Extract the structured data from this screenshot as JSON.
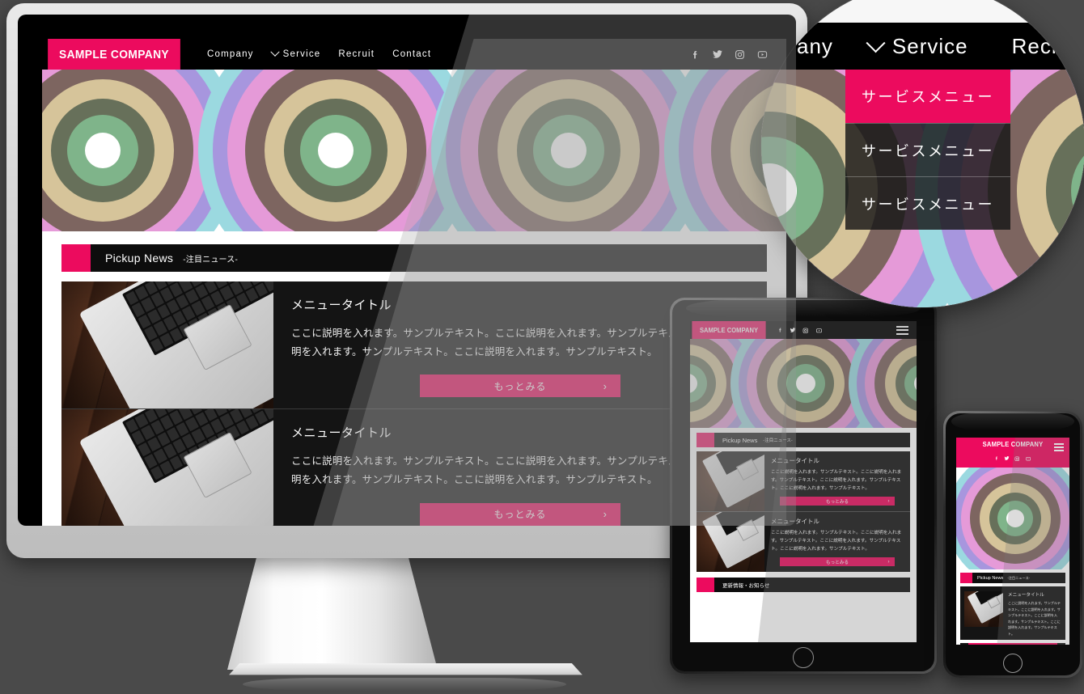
{
  "brand": {
    "name": "SAMPLE COMPANY",
    "accent": "#ec0b5e",
    "dark": "#000000"
  },
  "nav": {
    "items": [
      {
        "label": "Company",
        "has_dropdown": false
      },
      {
        "label": "Service",
        "has_dropdown": true
      },
      {
        "label": "Recruit",
        "has_dropdown": false
      },
      {
        "label": "Contact",
        "has_dropdown": false
      }
    ]
  },
  "social": [
    {
      "name": "facebook-icon",
      "glyph": "f"
    },
    {
      "name": "twitter-icon",
      "glyph": "t"
    },
    {
      "name": "instagram-icon",
      "glyph": "ig"
    },
    {
      "name": "youtube-icon",
      "glyph": "yt"
    }
  ],
  "pickup_news": {
    "en": "Pickup News",
    "ja": "-注目ニュース-"
  },
  "updates_section": {
    "ja": "更新情報・お知らせ"
  },
  "cards": [
    {
      "title": "メニュータイトル",
      "text": "ここに説明を入れます。サンプルテキスト。ここに説明を入れます。サンプルテキスト。ここに説明を入れます。サンプルテキスト。ここに説明を入れます。サンプルテキスト。",
      "button": "もっとみる",
      "button_arrow": "›"
    },
    {
      "title": "メニュータイトル",
      "text": "ここに説明を入れます。サンプルテキスト。ここに説明を入れます。サンプルテキスト。ここに説明を入れます。サンプルテキスト。ここに説明を入れます。サンプルテキスト。",
      "button": "もっとみる",
      "button_arrow": "›"
    }
  ],
  "magnifier": {
    "nav_left": "any",
    "nav_service": "Service",
    "nav_right": "Recruit",
    "dropdown": [
      {
        "label": "サービスメニュー",
        "state": "active"
      },
      {
        "label": "サービスメニュー",
        "state": "normal"
      },
      {
        "label": "サービスメニュー",
        "state": "normal"
      }
    ]
  },
  "hero_rings": {
    "colors": [
      "#ffffff",
      "#7fb48a",
      "#67705a",
      "#d6c49a",
      "#7d6560",
      "#e59ad8",
      "#a796de",
      "#9bd9e0"
    ],
    "description": "concentric-rings-pattern"
  },
  "devices": [
    {
      "name": "desktop-monitor",
      "type": "imac"
    },
    {
      "name": "tablet",
      "type": "ipad"
    },
    {
      "name": "phone",
      "type": "iphone"
    }
  ],
  "page_bg": "#4a4a4a"
}
